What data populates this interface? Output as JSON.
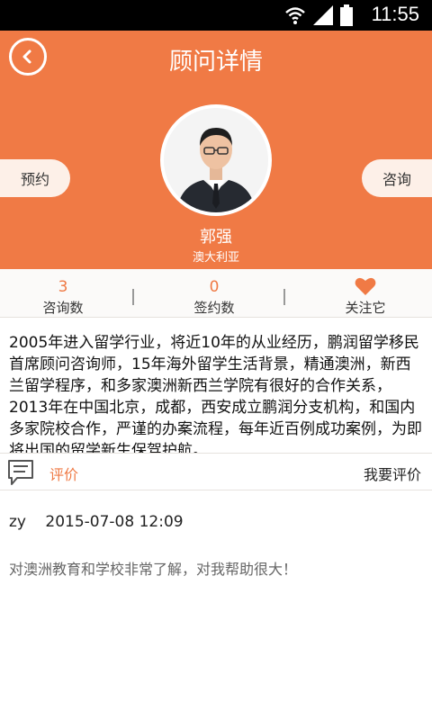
{
  "status_bar": {
    "time": "11:55",
    "icons": [
      "wifi-icon",
      "signal-icon",
      "battery-icon"
    ]
  },
  "header": {
    "title": "顾问详情",
    "back_icon": "back-arrow-icon"
  },
  "profile": {
    "name": "郭强",
    "country": "澳大利亚",
    "left_button": "预约",
    "right_button": "咨询"
  },
  "stats": [
    {
      "value": "3",
      "label": "咨询数"
    },
    {
      "value": "0",
      "label": "签约数"
    },
    {
      "label": "关注它",
      "icon": "heart-icon"
    }
  ],
  "description": "2005年进入留学行业，将近10年的从业经历，鹏润留学移民首席顾问咨询师，15年海外留学生活背景，精通澳洲，新西兰留学程序，和多家澳洲新西兰学院有很好的合作关系，2013年在中国北京，成都，西安成立鹏润分支机构，和国内多家院校合作，严谨的办案流程，每年近百例成功案例，为即将出国的留学新生保驾护航。",
  "comments_bar": {
    "label": "评价",
    "write_button": "我要评价",
    "icon": "comment-icon"
  },
  "comments": [
    {
      "user": "zy",
      "time": "2015-07-08 12:09",
      "text": "对澳洲教育和学校非常了解，对我帮助很大！"
    }
  ],
  "colors": {
    "accent": "#f07a45",
    "pill": "#fdf0e8"
  }
}
